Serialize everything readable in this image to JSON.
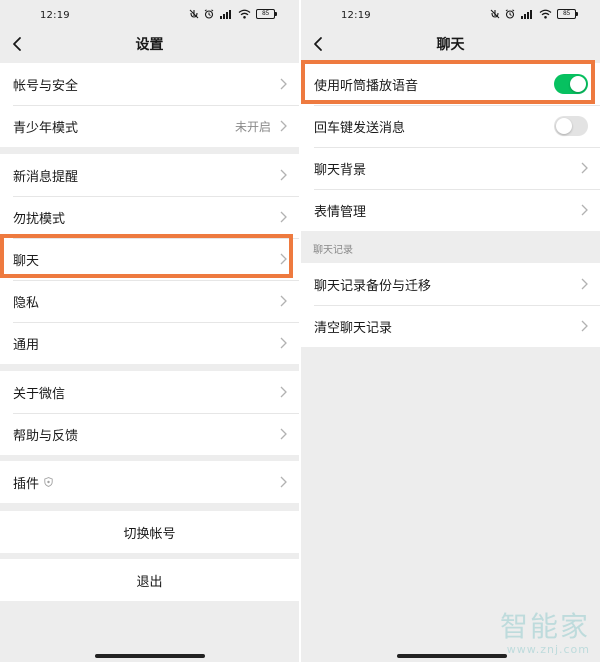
{
  "status_bar": {
    "time": "12:19",
    "battery": "85",
    "icons": [
      "mute-icon",
      "alarm-icon",
      "signal-icon",
      "wifi-icon",
      "battery-icon"
    ]
  },
  "settings": {
    "title": "设置",
    "back_icon": "chevron-left-icon",
    "items": {
      "account_security": "帐号与安全",
      "teen_mode": "青少年模式",
      "teen_mode_value": "未开启",
      "new_message": "新消息提醒",
      "do_not_disturb": "勿扰模式",
      "chat": "聊天",
      "privacy": "隐私",
      "general": "通用",
      "about": "关于微信",
      "help": "帮助与反馈",
      "plugins": "插件"
    },
    "switch_account": "切换帐号",
    "logout": "退出"
  },
  "chat": {
    "title": "聊天",
    "back_icon": "chevron-left-icon",
    "items": {
      "earpiece": "使用听筒播放语音",
      "earpiece_on": true,
      "enter_send": "回车键发送消息",
      "enter_send_on": false,
      "background": "聊天背景",
      "stickers": "表情管理"
    },
    "history_section": "聊天记录",
    "history_items": {
      "backup": "聊天记录备份与迁移",
      "clear": "清空聊天记录"
    }
  },
  "highlight_color": "#ee7a3f",
  "toggle_on_color": "#07c160",
  "watermark": {
    "text": "智能家",
    "url": "www.znj.com"
  }
}
